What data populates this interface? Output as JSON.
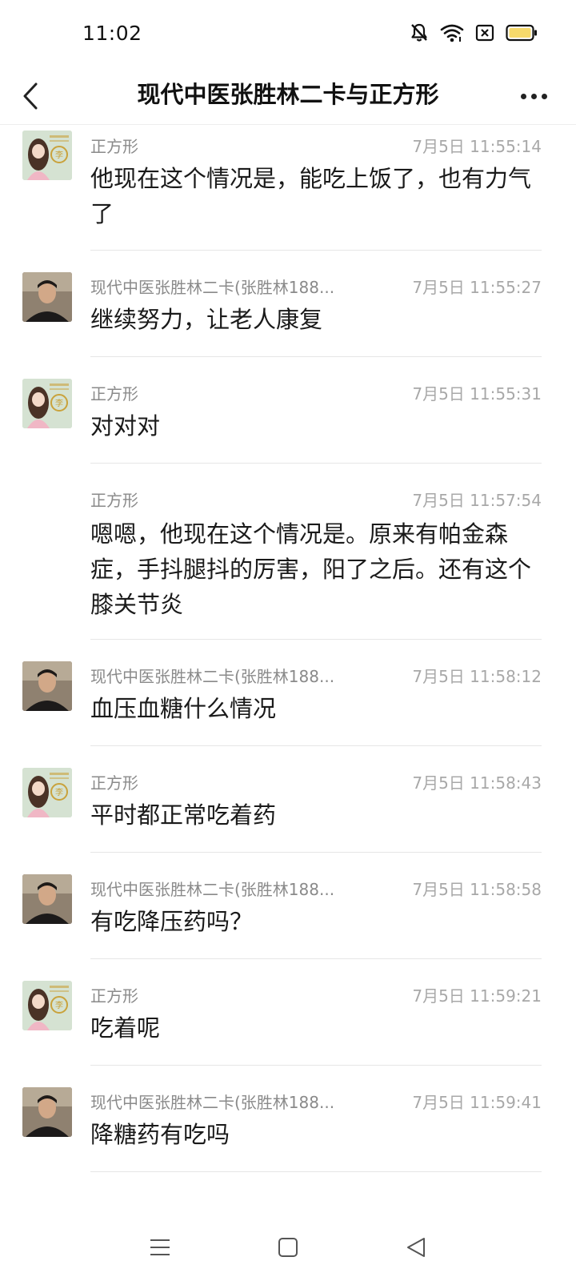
{
  "status_bar": {
    "time": "11:02",
    "icons": [
      "bell-muted-icon",
      "wifi-icon",
      "sim-x-icon",
      "battery-icon"
    ],
    "battery_color": "#f6d96b"
  },
  "header": {
    "title": "现代中医张胜林二卡与正方形",
    "back_icon": "chevron-left-icon",
    "more_icon": "more-dots-icon"
  },
  "messages": [
    {
      "sender": "正方形",
      "time": "7月5日 11:55:14",
      "text": "他现在这个情况是，能吃上饭了，也有力气了",
      "avatar": "girl"
    },
    {
      "sender": "现代中医张胜林二卡(张胜林188...",
      "time": "7月5日 11:55:27",
      "text": "继续努力，让老人康复",
      "avatar": "man"
    },
    {
      "sender": "正方形",
      "time": "7月5日 11:55:31",
      "text": "对对对",
      "avatar": "girl"
    },
    {
      "sender": "正方形",
      "time": "7月5日 11:57:54",
      "text": "嗯嗯，他现在这个情况是。原来有帕金森症，手抖腿抖的厉害，阳了之后。还有这个膝关节炎",
      "avatar": "none"
    },
    {
      "sender": "现代中医张胜林二卡(张胜林188...",
      "time": "7月5日 11:58:12",
      "text": "血压血糖什么情况",
      "avatar": "man"
    },
    {
      "sender": "正方形",
      "time": "7月5日 11:58:43",
      "text": "平时都正常吃着药",
      "avatar": "girl"
    },
    {
      "sender": "现代中医张胜林二卡(张胜林188...",
      "time": "7月5日 11:58:58",
      "text": "有吃降压药吗？",
      "avatar": "man"
    },
    {
      "sender": "正方形",
      "time": "7月5日 11:59:21",
      "text": "吃着呢",
      "avatar": "girl"
    },
    {
      "sender": "现代中医张胜林二卡(张胜林188...",
      "time": "7月5日 11:59:41",
      "text": "降糖药有吃吗",
      "avatar": "man"
    }
  ],
  "nav_bar": {
    "icons": [
      "menu-icon",
      "home-square-icon",
      "back-triangle-icon"
    ]
  }
}
